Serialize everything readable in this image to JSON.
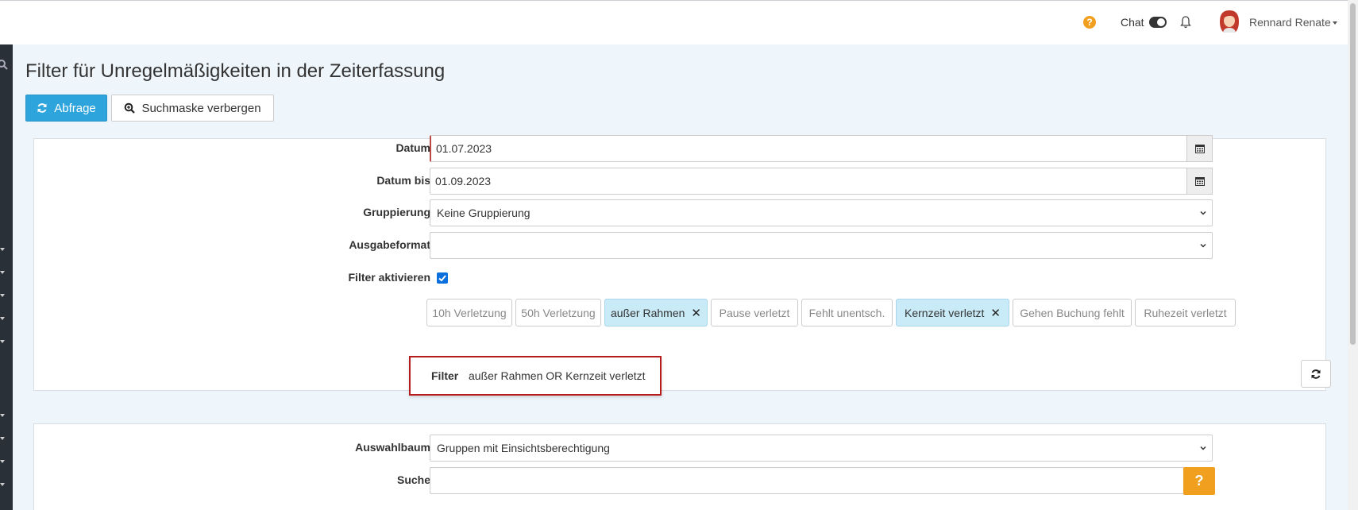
{
  "topbar": {
    "help_icon": "question-circle-icon",
    "chat_label": "Chat",
    "chat_toggle_on": true,
    "bell_icon": "bell-icon",
    "user_name": "Rennard Renate"
  },
  "page": {
    "title": "Filter für Unregelmäßigkeiten in der Zeiterfassung"
  },
  "toolbar": {
    "query_label": "Abfrage",
    "query_icon": "refresh-icon",
    "hide_search_label": "Suchmaske verbergen",
    "hide_search_icon": "zoom-icon"
  },
  "form": {
    "datum_label": "Datum",
    "datum_value": "01.07.2023",
    "datum_bis_label": "Datum bis",
    "datum_bis_value": "01.09.2023",
    "gruppierung_label": "Gruppierung",
    "gruppierung_value": "Keine Gruppierung",
    "ausgabeformat_label": "Ausgabeformat",
    "ausgabeformat_value": "",
    "filter_aktivieren_label": "Filter aktivieren",
    "filter_aktivieren_checked": true,
    "chips": [
      {
        "label": "10h Verletzung",
        "active": false
      },
      {
        "label": "50h Verletzung",
        "active": false
      },
      {
        "label": "außer Rahmen",
        "active": true
      },
      {
        "label": "Pause verletzt",
        "active": false
      },
      {
        "label": "Fehlt unentsch.",
        "active": false
      },
      {
        "label": "Kernzeit verletzt",
        "active": true
      },
      {
        "label": "Gehen Buchung fehlt",
        "active": false
      },
      {
        "label": "Ruhezeit verletzt",
        "active": false
      }
    ],
    "filter_label": "Filter",
    "filter_value": "außer Rahmen OR Kernzeit verletzt"
  },
  "form2": {
    "auswahlbaum_label": "Auswahlbaum",
    "auswahlbaum_value": "Gruppen mit Einsichtsberechtigung",
    "suche_label": "Suche",
    "suche_value": "",
    "help_label": "?"
  },
  "colors": {
    "primary": "#2ea4dc",
    "chip_active": "#c9eaf7",
    "help_orange": "#f0a01e",
    "highlight_red": "#b71c1c"
  }
}
